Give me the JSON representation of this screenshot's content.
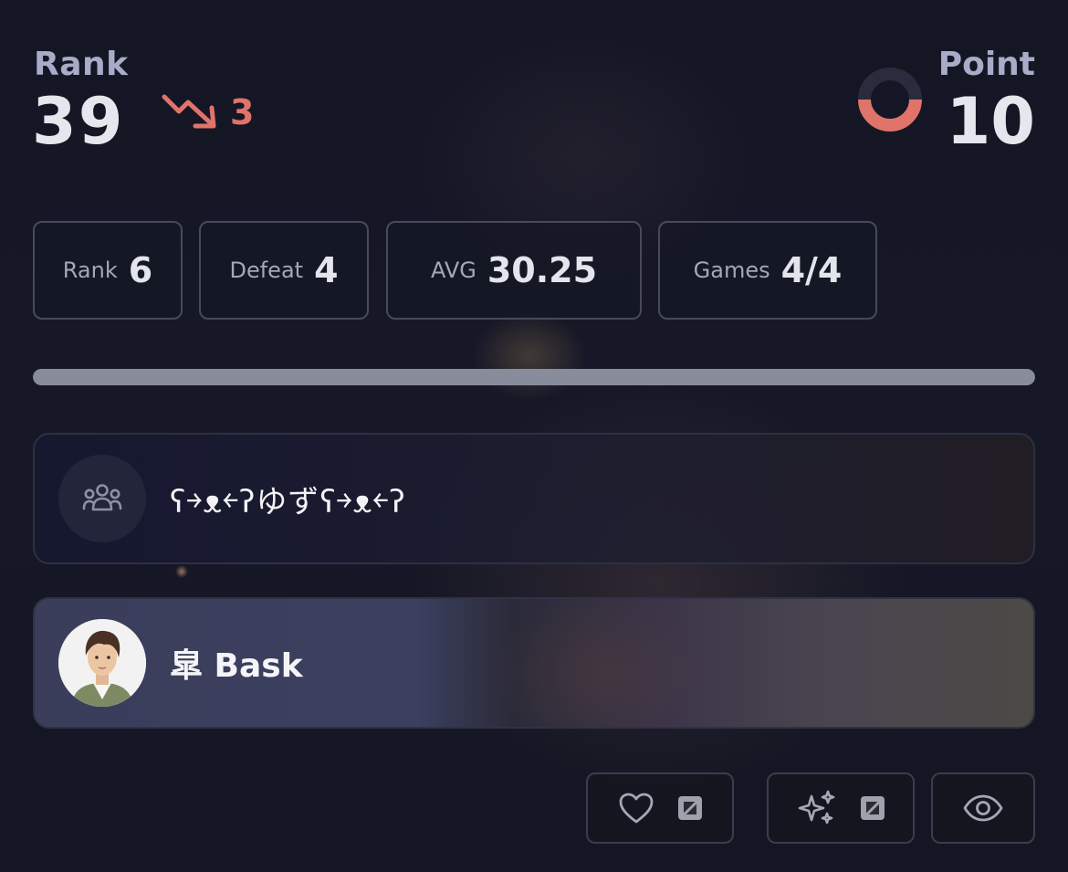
{
  "header": {
    "rank_label": "Rank",
    "rank_value": "39",
    "rank_change": "3",
    "rank_trend_icon": "trend-down-icon",
    "point_label": "Point",
    "point_value": "10"
  },
  "stats": [
    {
      "label": "Rank",
      "value": "6"
    },
    {
      "label": "Defeat",
      "value": "4"
    },
    {
      "label": "AVG",
      "value": "30.25"
    },
    {
      "label": "Games",
      "value": "4/4"
    }
  ],
  "progress": {
    "fraction": 1.0
  },
  "team": {
    "icon": "group-icon",
    "name": "ʕ￫ᴥ￩ʔゆずʕ￫ᴥ￩ʔ"
  },
  "player": {
    "avatar": "avatar-image",
    "name": "皐 Bask"
  },
  "actions": [
    {
      "icon": "heart-icon",
      "badge": "count-badge-icon"
    },
    {
      "icon": "sparkle-icon",
      "badge": "count-badge-icon"
    },
    {
      "icon": "eye-icon"
    }
  ],
  "colors": {
    "trend_down": "#e0736a",
    "ring_active": "#e0736a",
    "ring_track": "#2a2c3d",
    "progress_fill": "#888c9b"
  }
}
